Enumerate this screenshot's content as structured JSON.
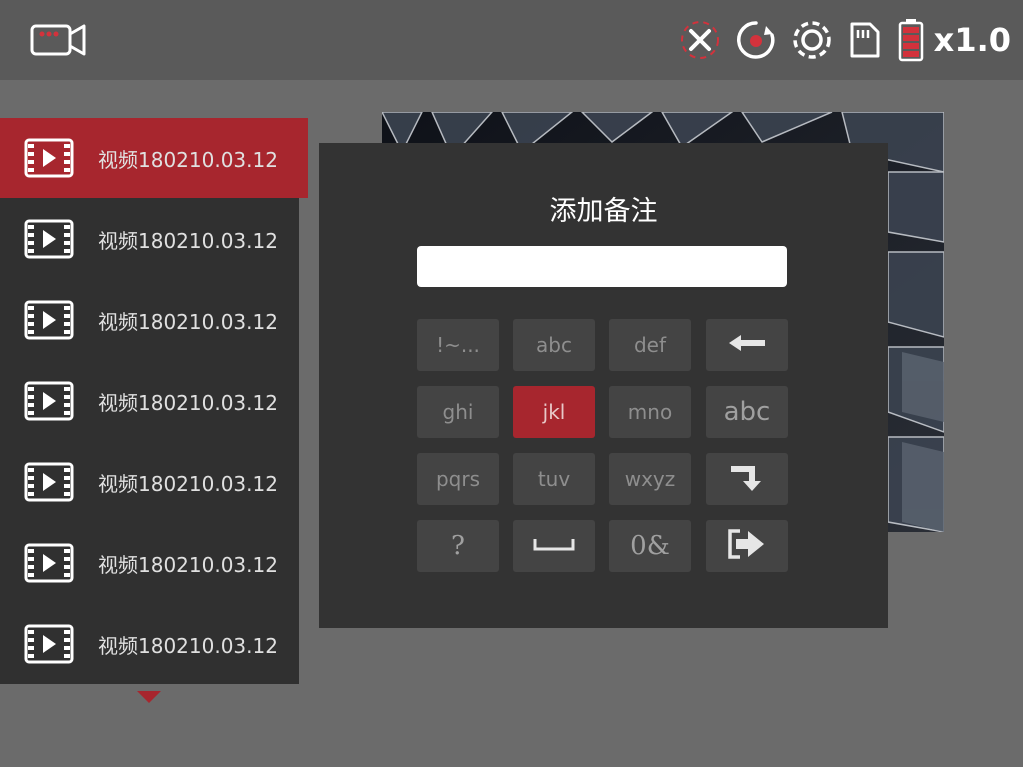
{
  "topbar": {
    "camera_icon": "video-camera-icon",
    "status_icons": [
      "tripod-off-icon",
      "record-icon",
      "settings-gear-icon",
      "sd-card-icon",
      "battery-icon"
    ],
    "zoom": "x1.0",
    "accent": "#a7262e"
  },
  "file_list": {
    "items": [
      {
        "label": "视频180210.03.12",
        "active": true
      },
      {
        "label": "视频180210.03.12",
        "active": false
      },
      {
        "label": "视频180210.03.12",
        "active": false
      },
      {
        "label": "视频180210.03.12",
        "active": false
      },
      {
        "label": "视频180210.03.12",
        "active": false
      },
      {
        "label": "视频180210.03.12",
        "active": false
      },
      {
        "label": "视频180210.03.12",
        "active": false
      }
    ]
  },
  "dialog": {
    "title": "添加备注",
    "input_value": "",
    "keys": [
      {
        "label": "!~...",
        "selected": false
      },
      {
        "label": "abc",
        "selected": false
      },
      {
        "label": "def",
        "selected": false
      },
      {
        "label": "",
        "icon": "backspace-arrow-icon"
      },
      {
        "label": "ghi",
        "selected": false
      },
      {
        "label": "jkl",
        "selected": true
      },
      {
        "label": "mno",
        "selected": false
      },
      {
        "label": "abc",
        "selected": false
      },
      {
        "label": "pqrs",
        "selected": false
      },
      {
        "label": "tuv",
        "selected": false
      },
      {
        "label": "wxyz",
        "selected": false
      },
      {
        "label": "",
        "icon": "enter-icon"
      },
      {
        "label": "?",
        "selected": false
      },
      {
        "label": "",
        "icon": "space-icon"
      },
      {
        "label": "0&",
        "selected": false
      },
      {
        "label": "",
        "icon": "confirm-exit-icon"
      }
    ]
  }
}
